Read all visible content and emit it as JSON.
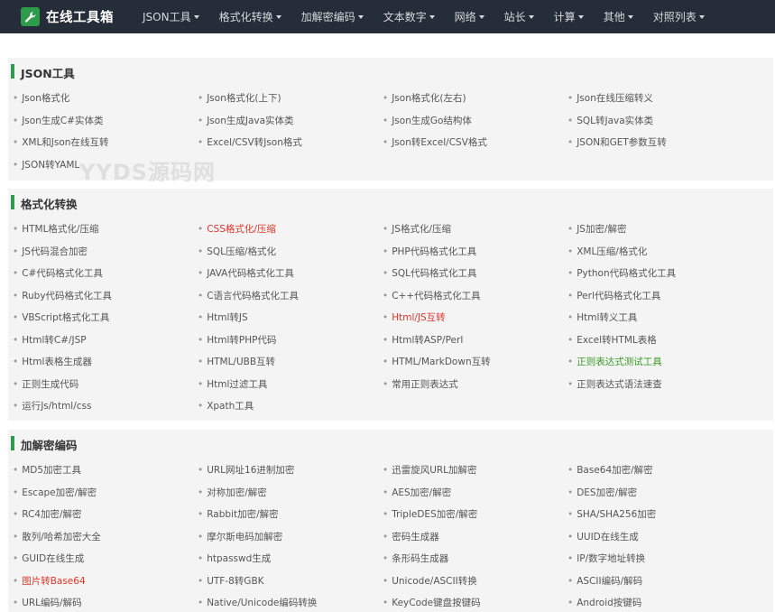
{
  "nav": {
    "brand": "在线工具箱",
    "items": [
      "JSON工具",
      "格式化转换",
      "加解密编码",
      "文本数字",
      "网络",
      "站长",
      "计算",
      "其他",
      "对照列表"
    ]
  },
  "watermark": "YYDS源码网",
  "colors": {
    "nav_bg": "#252d38",
    "accent": "#2e9b4a",
    "highlight_red": "#e0342a",
    "highlight_green": "#3a9a26"
  },
  "sections": [
    {
      "title": "JSON工具",
      "rows": [
        [
          "Json格式化",
          "Json格式化(上下)",
          "Json格式化(左右)",
          "Json在线压缩转义"
        ],
        [
          "Json生成C#实体类",
          "Json生成Java实体类",
          "Json生成Go结构体",
          "SQL转Java实体类"
        ],
        [
          "XML和Json在线互转",
          "Excel/CSV转Json格式",
          "Json转Excel/CSV格式",
          "JSON和GET参数互转"
        ],
        [
          "JSON转YAML"
        ]
      ]
    },
    {
      "title": "格式化转换",
      "rows": [
        [
          "HTML格式化/压缩",
          "CSS格式化/压缩",
          "JS格式化/压缩",
          "JS加密/解密"
        ],
        [
          "JS代码混合加密",
          "SQL压缩/格式化",
          "PHP代码格式化工具",
          "XML压缩/格式化"
        ],
        [
          "C#代码格式化工具",
          "JAVA代码格式化工具",
          "SQL代码格式化工具",
          "Python代码格式化工具"
        ],
        [
          "Ruby代码格式化工具",
          "C语言代码格式化工具",
          "C++代码格式化工具",
          "Perl代码格式化工具"
        ],
        [
          "VBScript格式化工具",
          "Html转JS",
          "Html/JS互转",
          "Html转义工具"
        ],
        [
          "Html转C#/JSP",
          "Html转PHP代码",
          "Html转ASP/Perl",
          "Excel转HTML表格"
        ],
        [
          "Html表格生成器",
          "HTML/UBB互转",
          "HTML/MarkDown互转",
          "正则表达式测试工具"
        ],
        [
          "正则生成代码",
          "Html过滤工具",
          "常用正则表达式",
          "正则表达式语法速查"
        ],
        [
          "运行Js/html/css",
          "Xpath工具"
        ]
      ]
    },
    {
      "title": "加解密编码",
      "rows": [
        [
          "MD5加密工具",
          "URL网址16进制加密",
          "迅雷旋风URL加解密",
          "Base64加密/解密"
        ],
        [
          "Escape加密/解密",
          "对称加密/解密",
          "AES加密/解密",
          "DES加密/解密"
        ],
        [
          "RC4加密/解密",
          "Rabbit加密/解密",
          "TripleDES加密/解密",
          "SHA/SHA256加密"
        ],
        [
          "散列/哈希加密大全",
          "摩尔斯电码加解密",
          "密码生成器",
          "UUID在线生成"
        ],
        [
          "GUID在线生成",
          "htpasswd生成",
          "条形码生成器",
          "IP/数字地址转换"
        ],
        [
          "图片转Base64",
          "UTF-8转GBK",
          "Unicode/ASCII转换",
          "ASCII编码/解码"
        ],
        [
          "URL编码/解码",
          "Native/Unicode编码转换",
          "KeyCode键盘按键码",
          "Android按键码"
        ]
      ]
    }
  ],
  "highlights": {
    "1.0.1": "red",
    "1.4.2": "red",
    "1.6.3": "green",
    "2.5.0": "red"
  }
}
